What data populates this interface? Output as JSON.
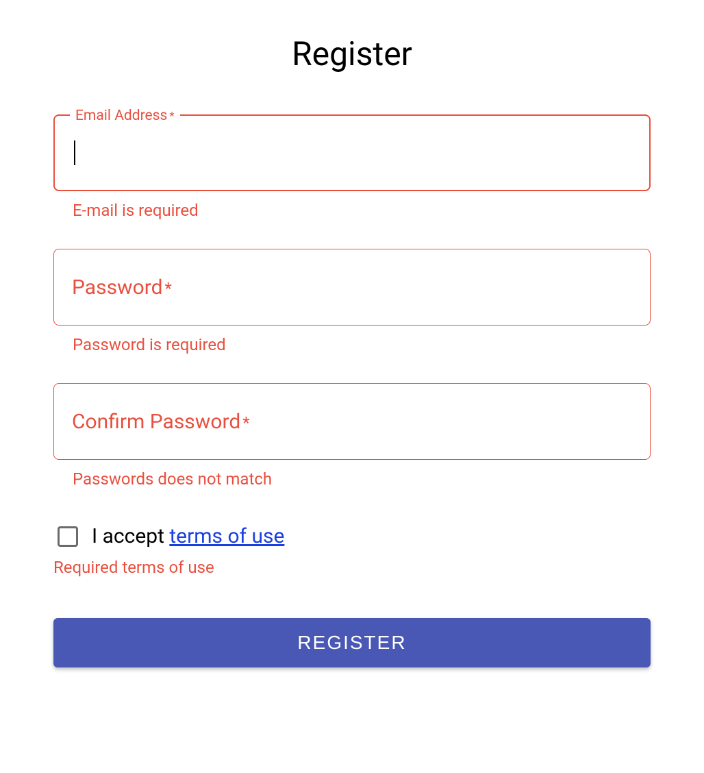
{
  "title": "Register",
  "fields": {
    "email": {
      "label": "Email Address",
      "required_mark": "*",
      "value": "",
      "error": "E-mail is required"
    },
    "password": {
      "label": "Password",
      "required_mark": "*",
      "value": "",
      "error": "Password is required"
    },
    "confirm_password": {
      "label": "Confirm Password",
      "required_mark": "*",
      "value": "",
      "error": "Passwords does not match"
    }
  },
  "terms": {
    "accept_prefix": "I accept ",
    "link_text": "terms of use",
    "error": "Required terms of use",
    "checked": false
  },
  "submit": {
    "label": "REGISTER"
  },
  "colors": {
    "error": "#e94f3e",
    "primary_button": "#4a58b5",
    "link": "#1a3fe0"
  }
}
